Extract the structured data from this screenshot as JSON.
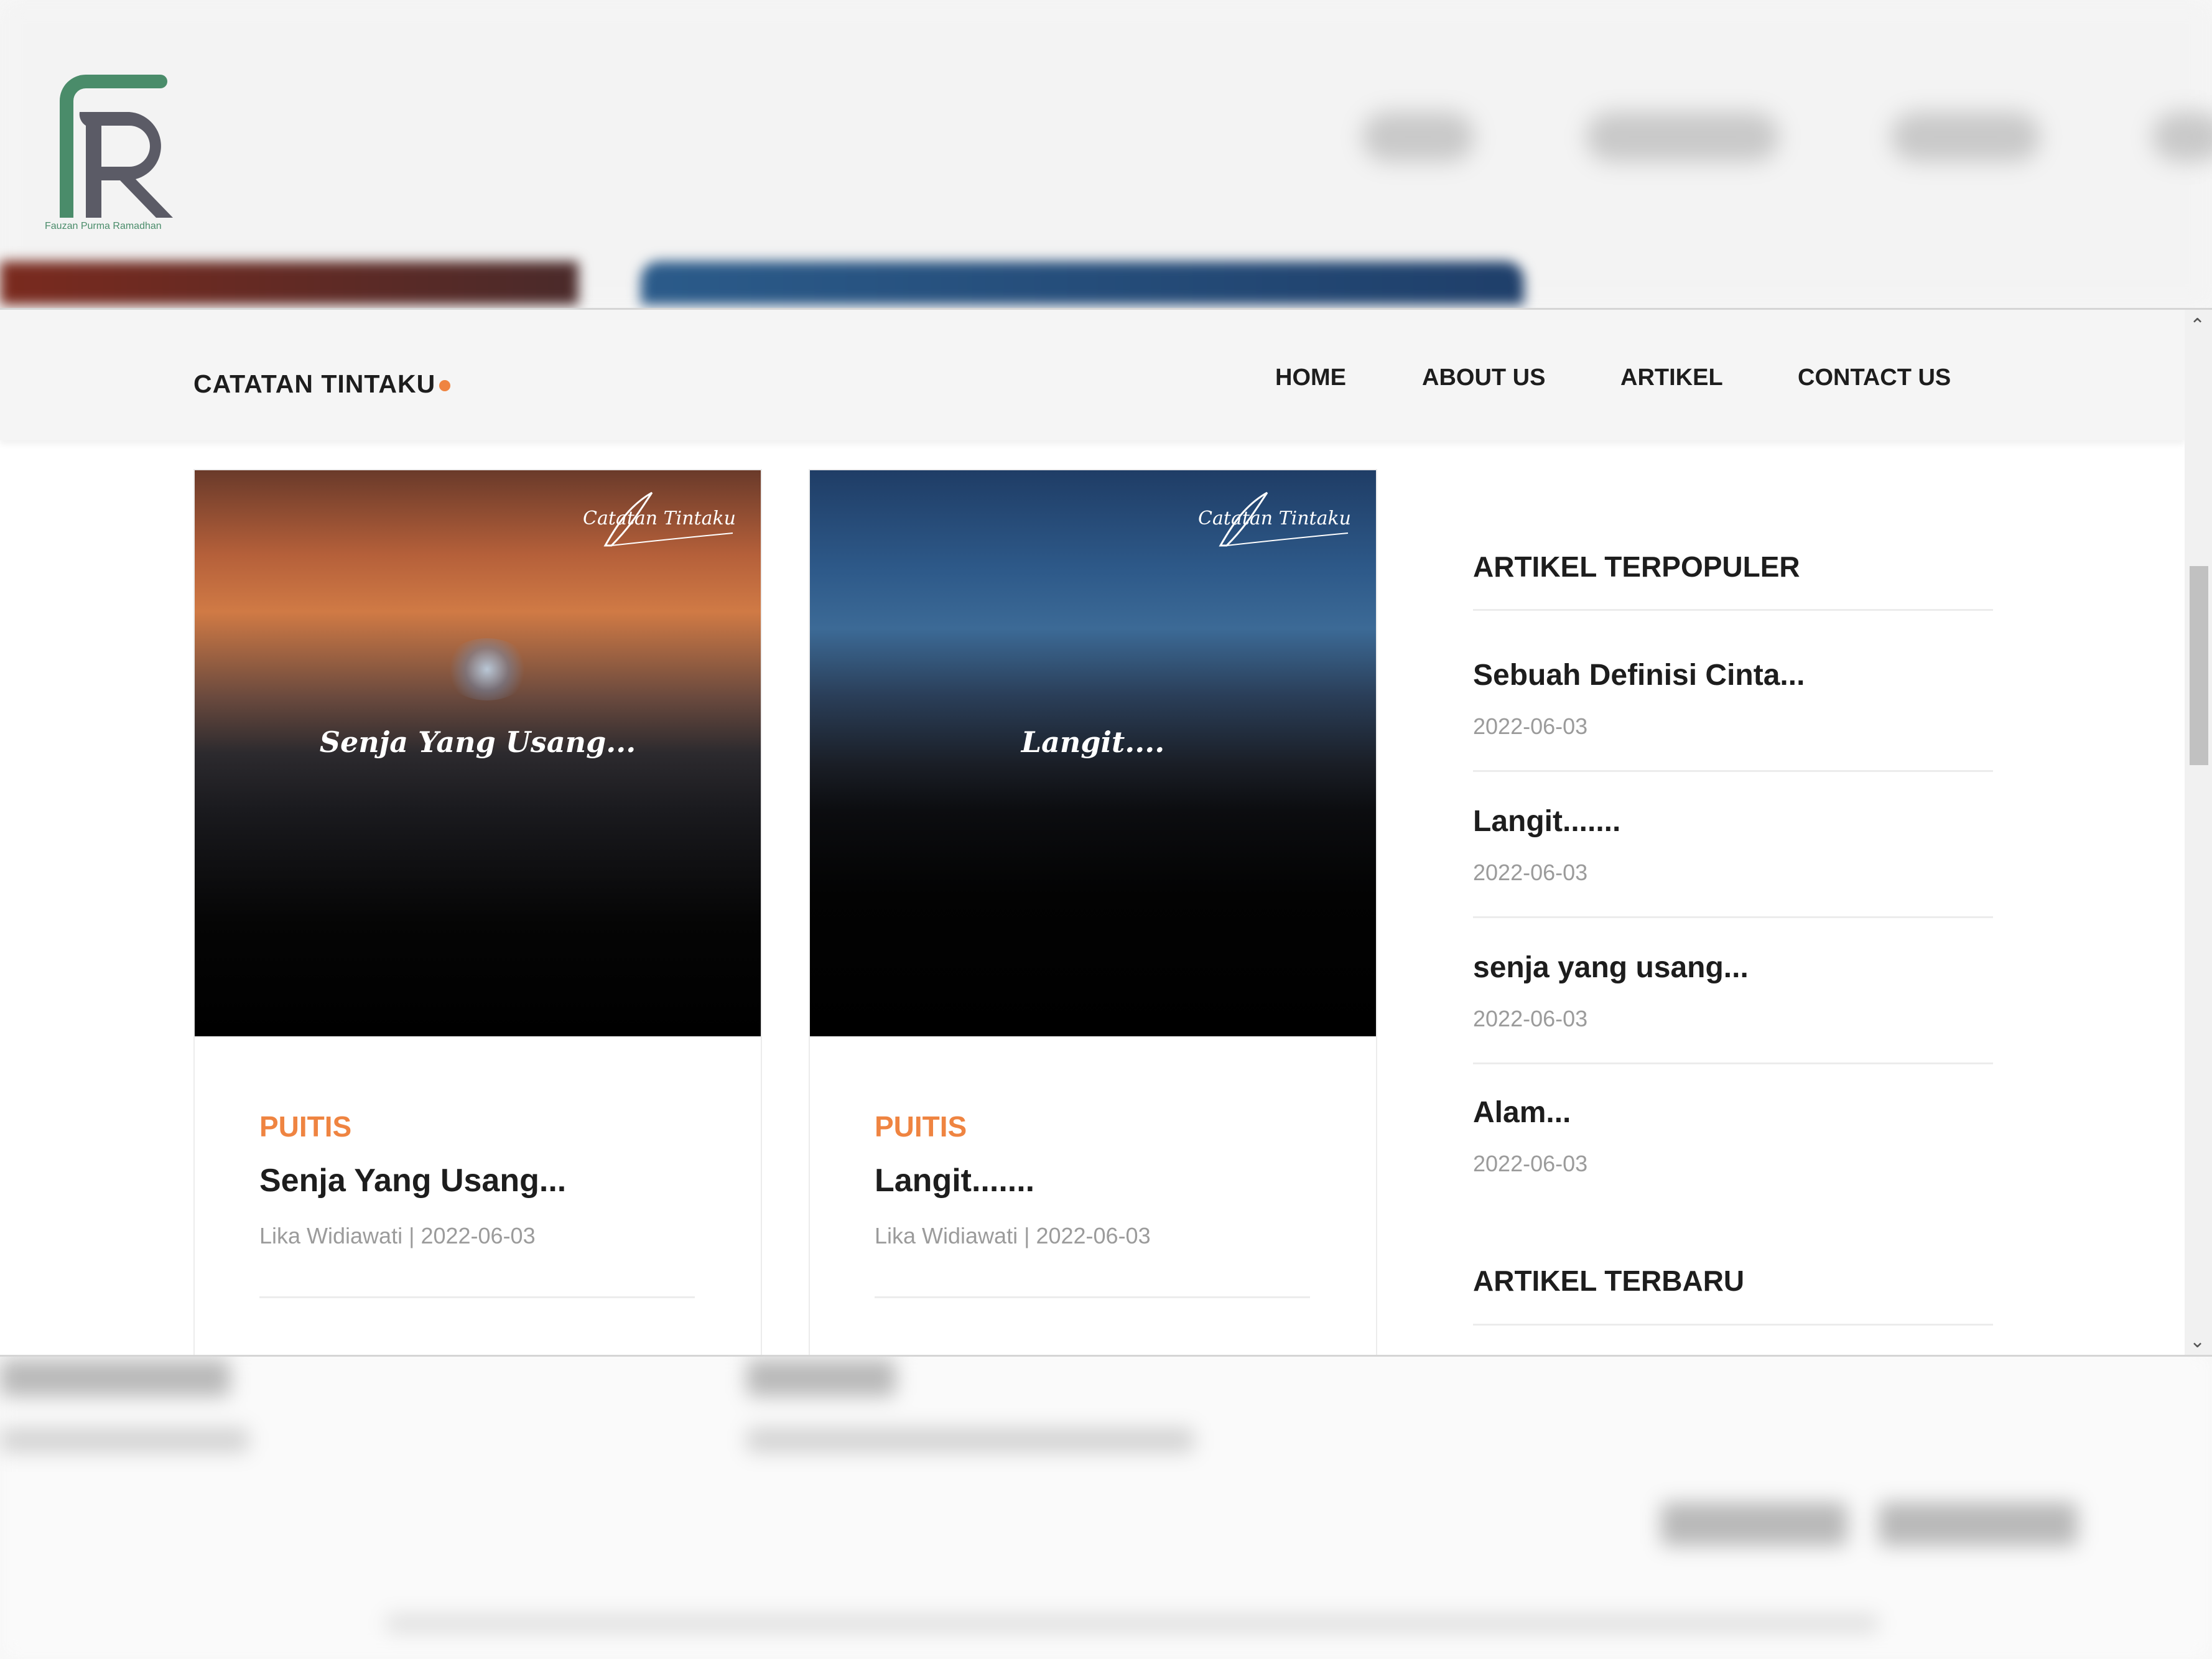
{
  "logo": {
    "letters": "FR",
    "caption": "Fauzan Purma Ramadhan"
  },
  "navbar": {
    "brand": "CATATAN TINTAKU",
    "items": [
      {
        "label": "HOME"
      },
      {
        "label": "ABOUT US"
      },
      {
        "label": "ARTIKEL"
      },
      {
        "label": "CONTACT US"
      }
    ]
  },
  "cards": [
    {
      "image_text": "Senja Yang Usang...",
      "watermark": "Catatan Tintaku",
      "category": "PUITIS",
      "title": "Senja Yang Usang...",
      "author": "Lika Widiawati",
      "date": "2022-06-03"
    },
    {
      "image_text": "Langit....",
      "watermark": "Catatan Tintaku",
      "category": "PUITIS",
      "title": "Langit.......",
      "author": "Lika Widiawati",
      "date": "2022-06-03"
    }
  ],
  "sidebar": {
    "popular_heading": "ARTIKEL TERPOPULER",
    "popular": [
      {
        "title": "Sebuah Definisi Cinta...",
        "date": "2022-06-03"
      },
      {
        "title": "Langit.......",
        "date": "2022-06-03"
      },
      {
        "title": "senja yang usang...",
        "date": "2022-06-03"
      },
      {
        "title": "Alam...",
        "date": "2022-06-03"
      }
    ],
    "latest_heading": "ARTIKEL TERBARU"
  },
  "colors": {
    "accent": "#ef8441",
    "text": "#1d1d1d",
    "muted": "#9b9b9b",
    "logo_green": "#4a8c6a",
    "logo_gray": "#5b5b66"
  }
}
